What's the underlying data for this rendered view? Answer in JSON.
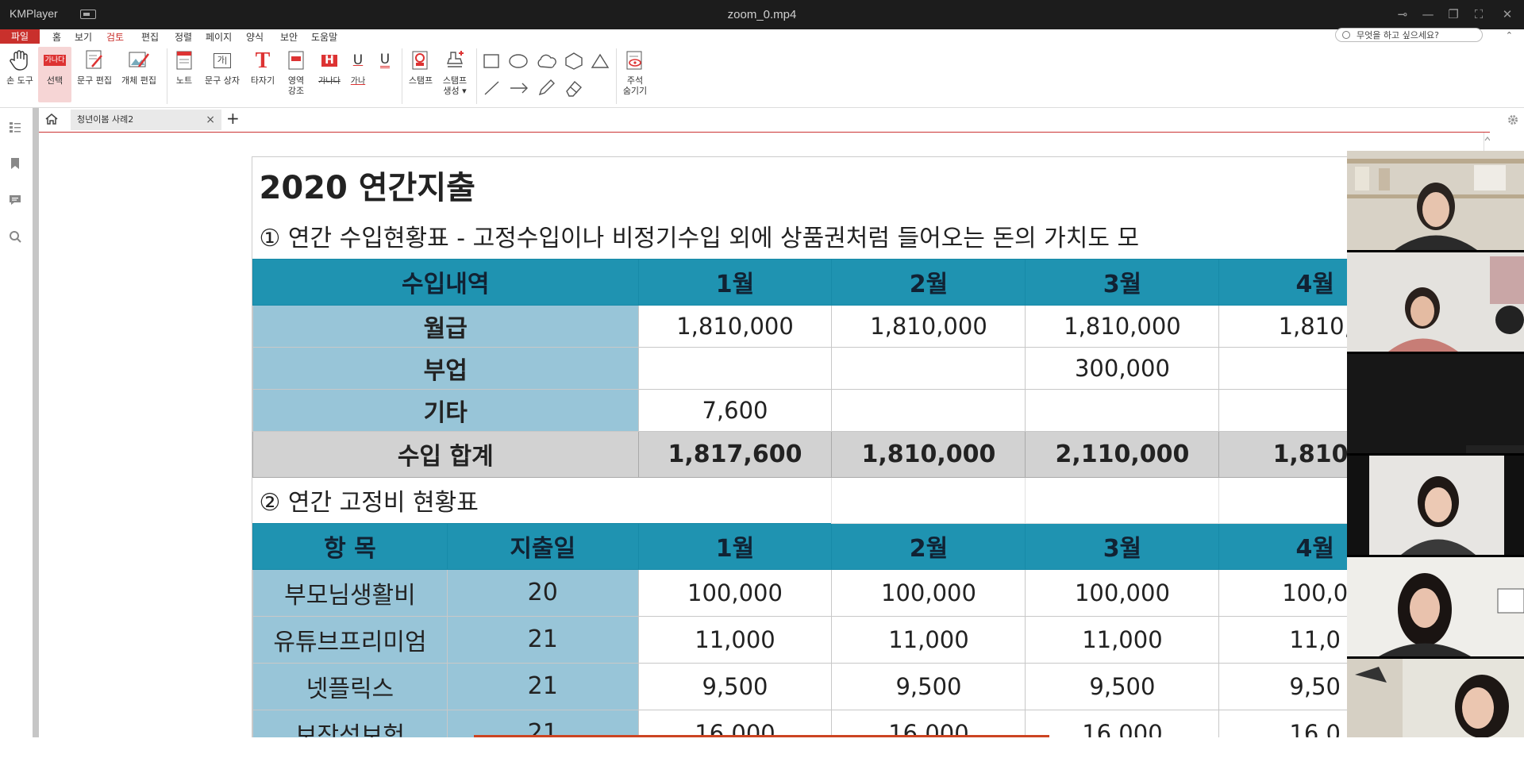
{
  "window": {
    "app_name": "KMPlayer",
    "title": "zoom_0.mp4"
  },
  "menu": {
    "file": "파일",
    "items": [
      "홈",
      "보기",
      "검토",
      "편집",
      "정렬",
      "페이지",
      "양식",
      "보안",
      "도움말"
    ],
    "active_index": 2,
    "ask_placeholder": "무엇을 하고 싶으세요?"
  },
  "ribbon": {
    "hand_tool": "손 도구",
    "select": "선택",
    "select_icon_text": "가나다",
    "text_edit": "문구 편집",
    "object_edit": "개체 편집",
    "note": "노트",
    "textbox": "문구 상자",
    "textbox_icon_text": "가|",
    "typewriter": "타자기",
    "area_highlight_1": "영역",
    "area_highlight_2": "강조",
    "strike_sample": "가나다",
    "underline_sample": "가나",
    "stamp": "스탬프",
    "stamp_create_1": "스탬프",
    "stamp_create_2": "생성 ▾",
    "hide_comment_1": "주석",
    "hide_comment_2": "숨기기",
    "highlight_letter": "H",
    "underline_letter": "U",
    "double_underline_letter": "U",
    "typewriter_letter": "T"
  },
  "tabs": {
    "doc_tab": "청년이봄 사례2",
    "close": "×",
    "add": "+"
  },
  "sheet": {
    "title": "2020 연간지출",
    "section1": "① 연간 수입현황표 - 고정수입이나 비정기수입 외에 상품권처럼 들어오는 돈의 가치도 모",
    "income_header": [
      "수입내역",
      "1월",
      "2월",
      "3월",
      "4월"
    ],
    "income_rows": [
      [
        "월급",
        "1,810,000",
        "1,810,000",
        "1,810,000",
        "1,810,"
      ],
      [
        "부업",
        "",
        "",
        "300,000",
        ""
      ],
      [
        "기타",
        "7,600",
        "",
        "",
        ""
      ]
    ],
    "income_total": [
      "수입 합계",
      "1,817,600",
      "1,810,000",
      "2,110,000",
      "1,810,"
    ],
    "section2": "② 연간 고정비 현황표",
    "fixed_header": [
      "항 목",
      "지출일",
      "1월",
      "2월",
      "3월",
      "4월"
    ],
    "fixed_rows": [
      [
        "부모님생활비",
        "20",
        "100,000",
        "100,000",
        "100,000",
        "100,0"
      ],
      [
        "유튜브프리미엄",
        "21",
        "11,000",
        "11,000",
        "11,000",
        "11,0"
      ],
      [
        "넷플릭스",
        "21",
        "9,500",
        "9,500",
        "9,500",
        "9,50"
      ],
      [
        "보장성보험",
        "21",
        "16,000",
        "16,000",
        "16,000",
        "16,0"
      ]
    ]
  },
  "colors": {
    "header_teal": "#1f93b1",
    "label_blue": "#98c5d8",
    "total_gray": "#d2d2d2",
    "accent_red": "#c9302c"
  }
}
